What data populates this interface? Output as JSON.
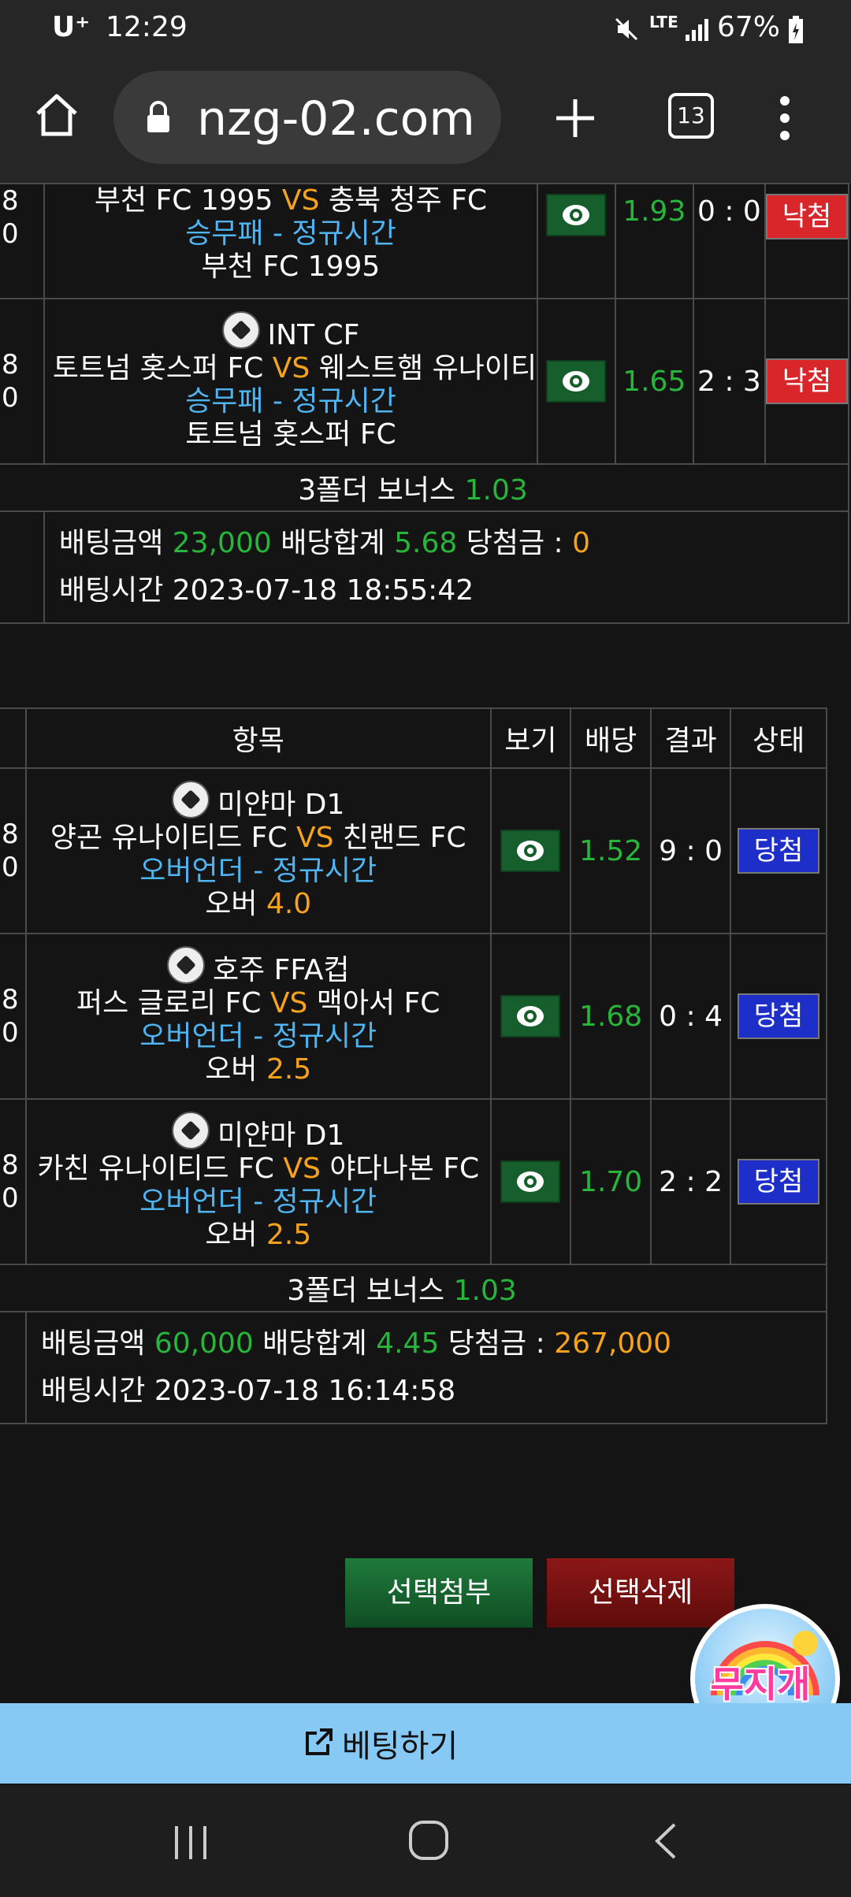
{
  "status_bar": {
    "carrier": "U⁺",
    "time": "12:29",
    "network": "LTE",
    "battery": "67%"
  },
  "browser": {
    "url": "nzg-02.com",
    "tab_count": "13"
  },
  "table1": {
    "rows": [
      {
        "left_cut": "8\n0",
        "league": "",
        "home": "부천 FC 1995",
        "vs": "VS",
        "away": "충북 청주 FC",
        "market": "승무패 - 정규시간",
        "pick_prefix": "",
        "pick": "부천 FC 1995",
        "odds": "1.93",
        "score": "0 : 0",
        "status": "낙첨"
      },
      {
        "left_cut": "8\n0",
        "league": "INT CF",
        "home": "토트넘 홋스퍼 FC",
        "vs": "VS",
        "away": "웨스트햄 유나이티",
        "market": "승무패 - 정규시간",
        "pick_prefix": "",
        "pick": "토트넘 홋스퍼 FC",
        "odds": "1.65",
        "score": "2 : 3",
        "status": "낙첨"
      }
    ],
    "bonus_label": "3폴더 보너스",
    "bonus_value": "1.03",
    "summary": {
      "bet_amount_label": "배팅금액",
      "bet_amount": "23,000",
      "odds_total_label": "배당합계",
      "odds_total": "5.68",
      "payout_label": "당첨금 :",
      "payout": "0",
      "time_label": "배팅시간",
      "time": "2023-07-18 18:55:42"
    }
  },
  "table2": {
    "headers": {
      "item": "항목",
      "view": "보기",
      "odds": "배당",
      "result": "결과",
      "status": "상태"
    },
    "rows": [
      {
        "league": "미얀마 D1",
        "home": "양곤 유나이티드 FC",
        "vs": "VS",
        "away": "친랜드 FC",
        "market": "오버언더 - 정규시간",
        "pick_prefix": "오버",
        "pick": "4.0",
        "odds": "1.52",
        "score": "9 : 0",
        "status": "당첨"
      },
      {
        "league": "호주 FFA컵",
        "home": "퍼스 글로리 FC",
        "vs": "VS",
        "away": "맥아서 FC",
        "market": "오버언더 - 정규시간",
        "pick_prefix": "오버",
        "pick": "2.5",
        "odds": "1.68",
        "score": "0 : 4",
        "status": "당첨"
      },
      {
        "league": "미얀마 D1",
        "home": "카친 유나이티드 FC",
        "vs": "VS",
        "away": "야다나본 FC",
        "market": "오버언더 - 정규시간",
        "pick_prefix": "오버",
        "pick": "2.5",
        "odds": "1.70",
        "score": "2 : 2",
        "status": "당첨"
      }
    ],
    "bonus_label": "3폴더 보너스",
    "bonus_value": "1.03",
    "summary": {
      "bet_amount_label": "배팅금액",
      "bet_amount": "60,000",
      "odds_total_label": "배당합계",
      "odds_total": "4.45",
      "payout_label": "당첨금 :",
      "payout": "267,000",
      "time_label": "배팅시간",
      "time": "2023-07-18 16:14:58"
    }
  },
  "buttons": {
    "attach": "선택첨부",
    "delete": "선택삭제"
  },
  "floating_logo": "무지개",
  "bet_bar_label": "베팅하기",
  "colors": {
    "win": "#1d2ec9",
    "lose": "#d8262b",
    "odds": "#27b53a",
    "vs": "#f7a21b",
    "market": "#4fb4f2"
  }
}
